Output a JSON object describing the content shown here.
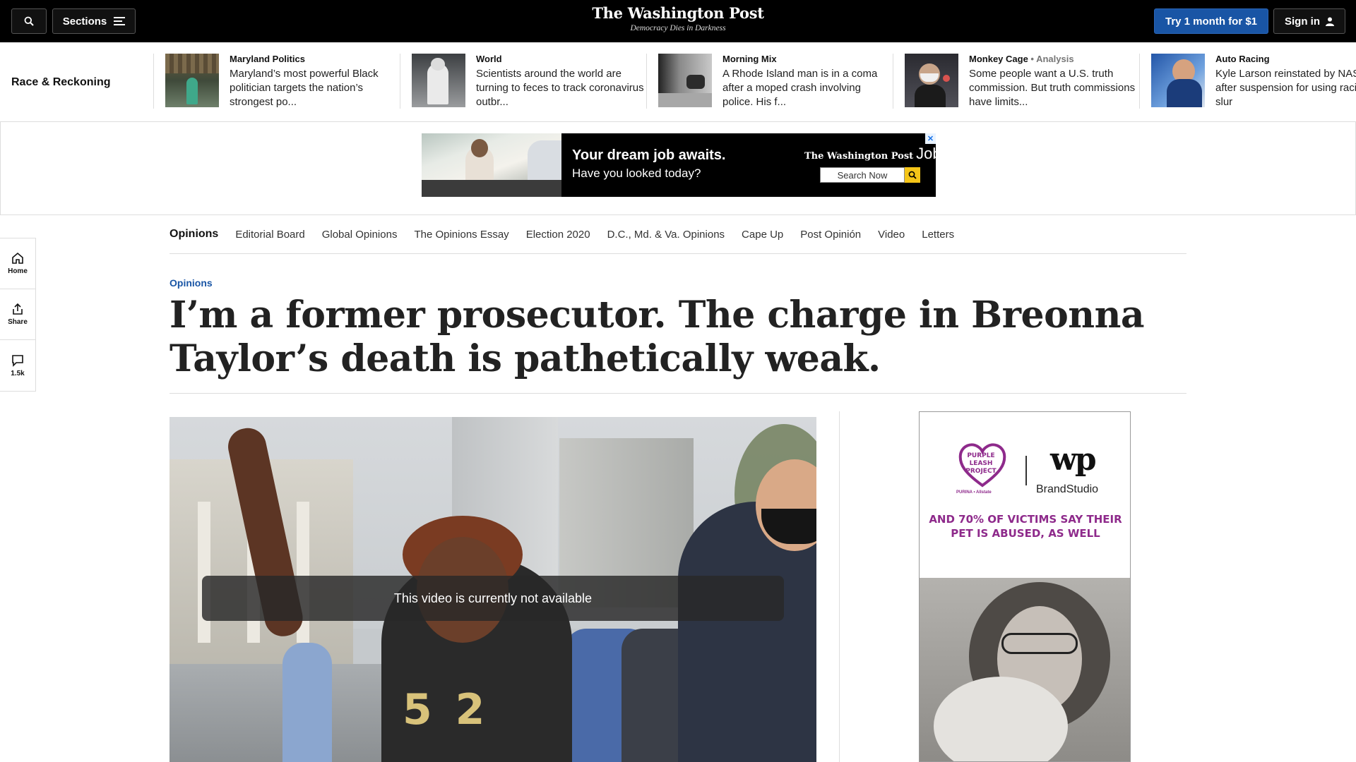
{
  "header": {
    "sections_label": "Sections",
    "logo": "The Washington Post",
    "tagline": "Democracy Dies in Darkness",
    "try_label": "Try 1 month for $1",
    "signin_label": "Sign in"
  },
  "strip": {
    "title": "Race & Reckoning",
    "stories": [
      {
        "kicker": "Maryland Politics",
        "analysis": "",
        "headline": "Maryland’s most powerful Black politician targets the nation’s strongest po..."
      },
      {
        "kicker": "World",
        "analysis": "",
        "headline": "Scientists around the world are turning to feces to track coronavirus outbr..."
      },
      {
        "kicker": "Morning Mix",
        "analysis": "",
        "headline": "A Rhode Island man is in a coma after a moped crash involving police. His f..."
      },
      {
        "kicker": "Monkey Cage",
        "analysis": " • Analysis",
        "headline": "Some people want a U.S. truth commission. But truth commissions have limits..."
      },
      {
        "kicker": "Auto Racing",
        "analysis": "",
        "headline": "Kyle Larson reinstated by NASCAR after suspension for using racial slur"
      }
    ]
  },
  "banner_ad": {
    "headline": "Your dream job awaits.",
    "subline": "Have you looked today?",
    "brand": "The Washington Post",
    "brand_suffix": "Jobs",
    "search_label": "Search Now",
    "close_glyph": "✕"
  },
  "opinions_nav": {
    "items": [
      "Opinions",
      "Editorial Board",
      "Global Opinions",
      "The Opinions Essay",
      "Election 2020",
      "D.C., Md. & Va. Opinions",
      "Cape Up",
      "Post Opinión",
      "Video",
      "Letters"
    ]
  },
  "rail": {
    "home": "Home",
    "share": "Share",
    "comments": "1.5k"
  },
  "article": {
    "section": "Opinions",
    "headline": "I’m a former prosecutor. The charge in Breonna Taylor’s death is pathetically weak.",
    "video_message": "This video is currently not available",
    "shirt_text": "5 2"
  },
  "side_ad": {
    "logo_text": "PURPLE LEASH PROJECT",
    "logo_sub": "PURINA • Allstate",
    "wp_mark": "wp",
    "brand": "BrandStudio",
    "copy": "AND 70% OF VICTIMS SAY THEIR PET IS ABUSED, AS WELL"
  },
  "colors": {
    "accent_blue": "#1955a5",
    "ad_purple": "#8e2a8b",
    "jobs_search_button": "#f5c518"
  },
  "icons": [
    "search-icon",
    "menu-icon",
    "user-icon",
    "home-icon",
    "share-icon",
    "comment-icon",
    "magnifier-icon"
  ]
}
